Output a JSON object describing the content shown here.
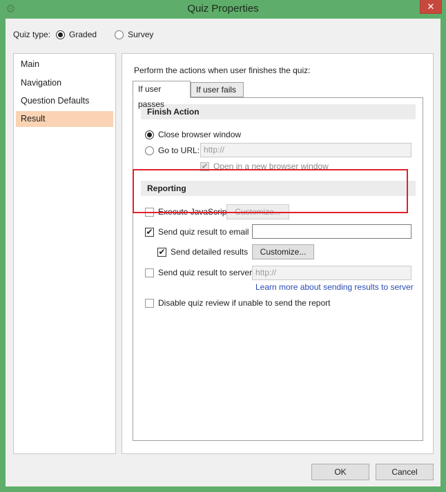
{
  "window": {
    "title": "Quiz Properties",
    "close_glyph": "✕"
  },
  "quiz_type": {
    "label": "Quiz type:",
    "options": [
      {
        "label": "Graded",
        "selected": true
      },
      {
        "label": "Survey",
        "selected": false
      }
    ]
  },
  "sidebar": {
    "items": [
      {
        "label": "Main",
        "selected": false
      },
      {
        "label": "Navigation",
        "selected": false
      },
      {
        "label": "Question Defaults",
        "selected": false
      },
      {
        "label": "Result",
        "selected": true
      }
    ]
  },
  "main": {
    "intro": "Perform the actions when user finishes the quiz:",
    "tabs": [
      {
        "label": "If user passes",
        "active": true
      },
      {
        "label": "If user fails",
        "active": false
      }
    ],
    "finish_action": {
      "heading": "Finish Action",
      "close_browser": "Close browser window",
      "go_to_url": "Go to URL:",
      "url_placeholder": "http://",
      "open_new_window": "Open in a new browser window"
    },
    "reporting": {
      "heading": "Reporting",
      "execute_js": "Execute JavaScript",
      "execute_js_customize": "Customize...",
      "send_email": "Send quiz result to email",
      "email_value": "",
      "send_detailed": "Send detailed results",
      "detailed_customize": "Customize...",
      "send_server": "Send quiz result to server",
      "server_placeholder": "http://",
      "learn_more": "Learn more about sending results to server",
      "disable_review": "Disable quiz review if unable to send the report"
    }
  },
  "footer": {
    "ok": "OK",
    "cancel": "Cancel"
  },
  "check_glyph": "✔",
  "colors": {
    "highlight": "#e0202a",
    "selected_item": "#f9d3b3",
    "title_bar": "#5fad6a"
  }
}
